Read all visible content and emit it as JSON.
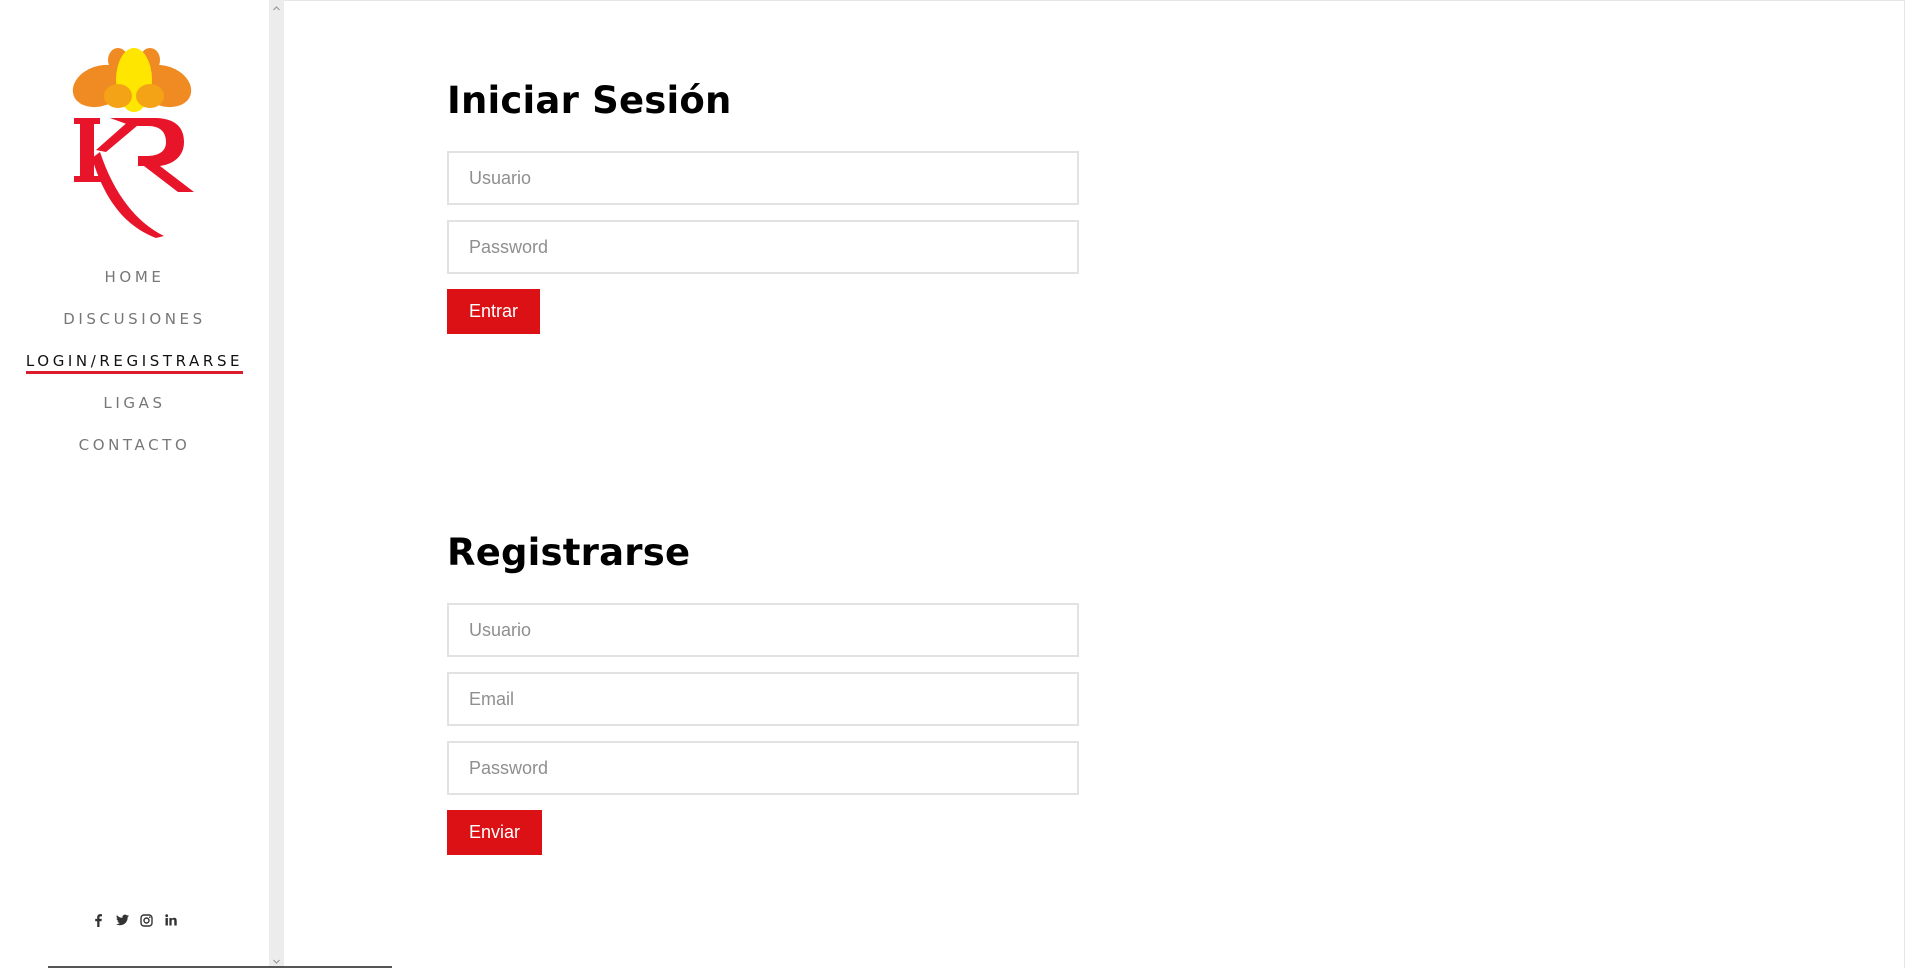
{
  "colors": {
    "accent": "#dc1116",
    "nav_underline": "#dc1c2e"
  },
  "logo": {
    "text": "KR",
    "icon": "lotus-kr-logo"
  },
  "nav": {
    "items": [
      {
        "label": "HOME"
      },
      {
        "label": "DISCUSIONES"
      },
      {
        "label": "LOGIN/REGISTRARSE",
        "active": true
      },
      {
        "label": "LIGAS"
      },
      {
        "label": "CONTACTO"
      }
    ]
  },
  "social": {
    "icons": [
      "facebook-icon",
      "twitter-icon",
      "instagram-icon",
      "linkedin-icon"
    ]
  },
  "login": {
    "title": "Iniciar Sesión",
    "username_placeholder": "Usuario",
    "password_placeholder": "Password",
    "submit_label": "Entrar"
  },
  "register": {
    "title": "Registrarse",
    "username_placeholder": "Usuario",
    "email_placeholder": "Email",
    "password_placeholder": "Password",
    "submit_label": "Enviar"
  }
}
